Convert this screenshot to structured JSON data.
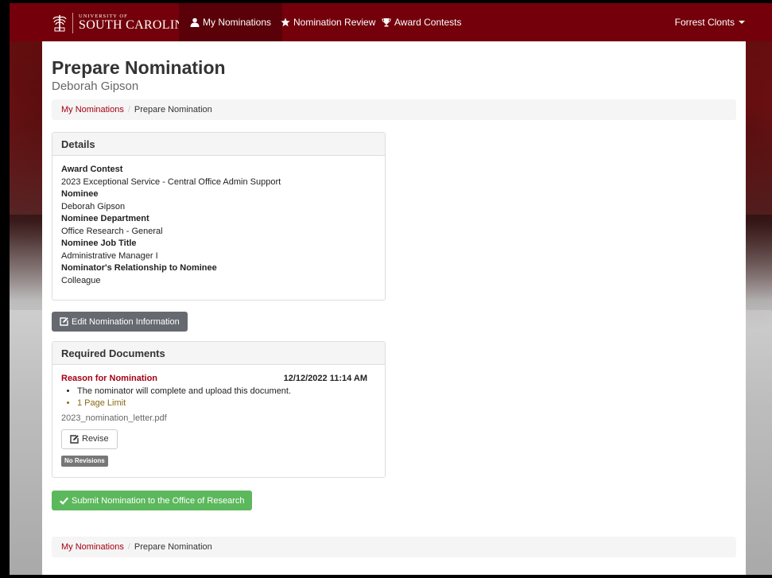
{
  "brand": {
    "line1": "UNIVERSITY OF",
    "line2": "SOUTH CAROLINA"
  },
  "nav": {
    "items": [
      {
        "label": "My Nominations",
        "icon": "user-icon",
        "active": true
      },
      {
        "label": "Nomination Review",
        "icon": "star-icon"
      },
      {
        "label": "Award Contests",
        "icon": "trophy-icon"
      }
    ],
    "user": "Forrest Clonts"
  },
  "page": {
    "title": "Prepare Nomination",
    "subtitle": "Deborah Gipson"
  },
  "breadcrumb": {
    "parent": "My Nominations",
    "separator": "/",
    "current": "Prepare Nomination"
  },
  "details": {
    "heading": "Details",
    "fields": [
      {
        "label": "Award Contest",
        "value": "2023 Exceptional Service - Central Office Admin Support"
      },
      {
        "label": "Nominee",
        "value": "Deborah Gipson"
      },
      {
        "label": "Nominee Department",
        "value": "Office Research - General"
      },
      {
        "label": "Nominee Job Title",
        "value": "Administrative Manager I"
      },
      {
        "label": "Nominator's Relationship to Nominee",
        "value": "Colleague"
      }
    ]
  },
  "edit_button": "Edit Nomination Information",
  "required_documents": {
    "heading": "Required Documents",
    "document": {
      "title": "Reason for Nomination",
      "date": "12/12/2022 11:14 AM",
      "notes": [
        "The nominator will complete and upload this document.",
        "1 Page Limit"
      ],
      "filename": "2023_nomination_letter.pdf",
      "revise_label": "Revise",
      "revisions_badge": "No Revisions"
    }
  },
  "submit_button": "Submit Nomination to the Office of Research",
  "colors": {
    "brand": "#73000a",
    "link": "#a40012",
    "success": "#5cb85c"
  }
}
